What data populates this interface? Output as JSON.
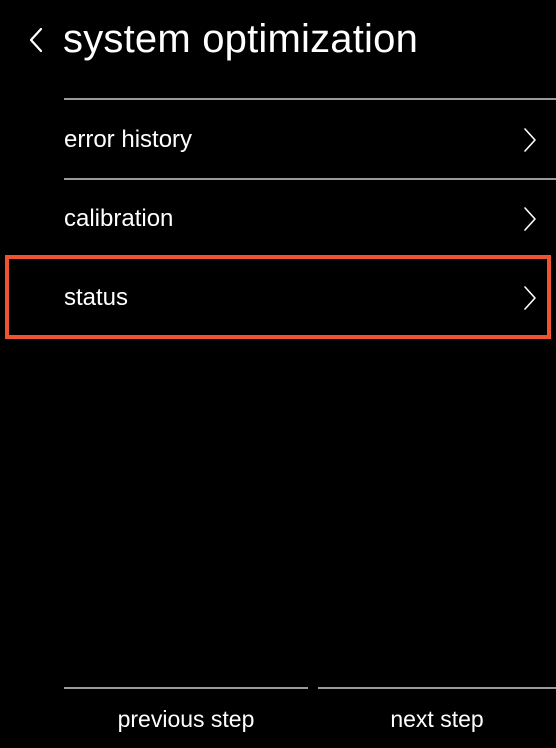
{
  "header": {
    "title": "system optimization",
    "back_icon": "chevron-left-icon"
  },
  "menu": {
    "items": [
      {
        "label": "error history",
        "icon": "chevron-right-icon",
        "highlighted": false
      },
      {
        "label": "calibration",
        "icon": "chevron-right-icon",
        "highlighted": false
      },
      {
        "label": "status",
        "icon": "chevron-right-icon",
        "highlighted": true
      }
    ]
  },
  "footer": {
    "previous_label": "previous step",
    "next_label": "next step"
  },
  "colors": {
    "background": "#000000",
    "text": "#ffffff",
    "divider": "#9a9a9a",
    "highlight": "#ef5332"
  }
}
